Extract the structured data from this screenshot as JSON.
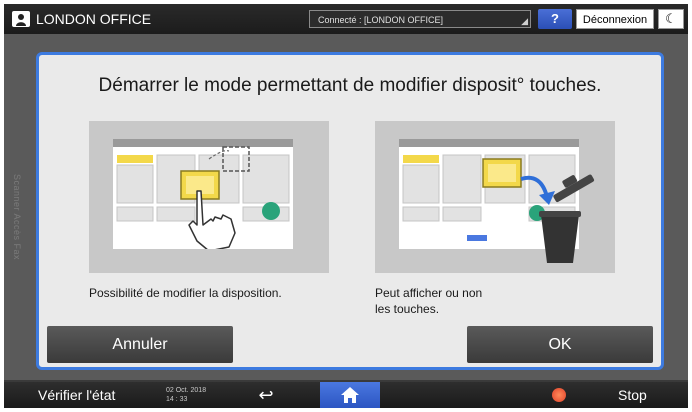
{
  "topbar": {
    "title": "LONDON OFFICE",
    "connection": "Connecté : [LONDON OFFICE]",
    "help_label": "?",
    "logout_label": "Déconnexion",
    "energy_label": "☾"
  },
  "background": {
    "vertical_text": "Scanner Accès Fax"
  },
  "dialog": {
    "title": "Démarrer le mode permettant de modifier disposit° touches.",
    "left_caption": "Possibilité de modifier la disposition.",
    "right_caption_line1": "Peut afficher ou non",
    "right_caption_line2": "les touches.",
    "cancel_label": "Annuler",
    "ok_label": "OK"
  },
  "bottombar": {
    "check_status": "Vérifier l'état",
    "date": "02 Oct. 2018",
    "time": "14 : 33",
    "back_icon": "↩",
    "stop_label": "Stop"
  },
  "colors": {
    "accent": "#3d7be0",
    "dialog_bg": "#eaeaea",
    "button_dark": "#444444",
    "green_dot": "#2aa37a",
    "yellow_key": "#f3d84a"
  }
}
